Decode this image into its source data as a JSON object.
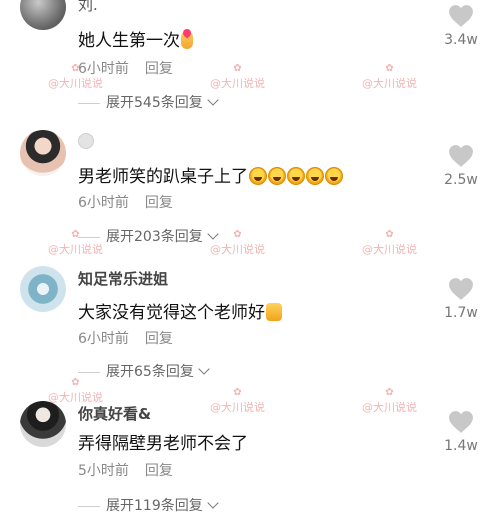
{
  "comments": [
    {
      "username": "刘.",
      "text": "她人生第一次",
      "emoji": "finger-heart",
      "time": "6小时前",
      "reply_label": "回复",
      "expand_label": "展开545条回复",
      "likes": "3.4w"
    },
    {
      "username": "",
      "text": "男老师笑的趴桌子上了",
      "emoji": "laugh-crying x5",
      "time": "6小时前",
      "reply_label": "回复",
      "expand_label": "展开203条回复",
      "likes": "2.5w"
    },
    {
      "username": "知足常乐进姐",
      "text": "大家没有觉得这个老师好",
      "emoji": "thumbs-up",
      "time": "6小时前",
      "reply_label": "回复",
      "expand_label": "展开65条回复",
      "likes": "1.7w"
    },
    {
      "username": "你真好看&",
      "text": "弄得隔壁男老师不会了",
      "emoji": "",
      "time": "5小时前",
      "reply_label": "回复",
      "expand_label": "展开119条回复",
      "likes": "1.4w"
    }
  ],
  "watermark": {
    "text": "@大川说说",
    "logo": "✿"
  },
  "colors": {
    "heart": "#c8c8c8",
    "watermark": "#f2a6a6"
  }
}
